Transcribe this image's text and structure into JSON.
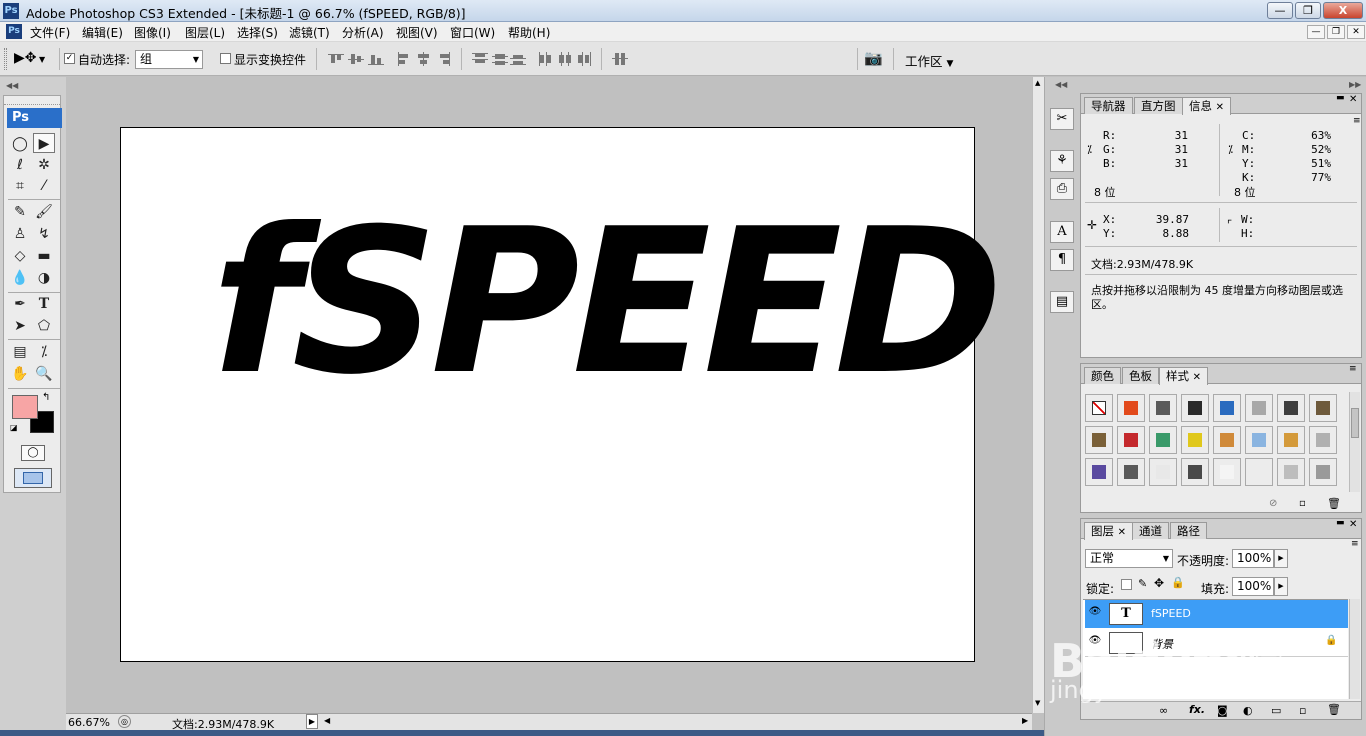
{
  "window": {
    "app_icon": "Ps",
    "title": "Adobe Photoshop CS3 Extended - [未标题-1 @ 66.7% (fSPEED, RGB/8)]",
    "min_label": "—",
    "max_label": "❐",
    "close_label": "X"
  },
  "menubar": {
    "icon": "Ps",
    "items": [
      "文件(F)",
      "编辑(E)",
      "图像(I)",
      "图层(L)",
      "选择(S)",
      "滤镜(T)",
      "分析(A)",
      "视图(V)",
      "窗口(W)",
      "帮助(H)"
    ]
  },
  "options": {
    "auto_select_label": "自动选择:",
    "auto_select_checked": true,
    "auto_select_value": "组",
    "show_transform_label": "显示变换控件",
    "show_transform_checked": false,
    "workspace_label": "工作区"
  },
  "toolbox": {
    "header": "Ps",
    "foreground_color": "#f7a5a5",
    "background_color": "#000000"
  },
  "canvas": {
    "text": "fSPEED"
  },
  "status": {
    "zoom": "66.67%",
    "doc_size": "文档:2.93M/478.9K"
  },
  "info_panel": {
    "tabs": [
      "导航器",
      "直方图",
      "信息"
    ],
    "active_tab": "信息",
    "rgb": [
      {
        "k": "R:",
        "v": "31"
      },
      {
        "k": "G:",
        "v": "31"
      },
      {
        "k": "B:",
        "v": "31"
      }
    ],
    "cmyk": [
      {
        "k": "C:",
        "v": "63%"
      },
      {
        "k": "M:",
        "v": "52%"
      },
      {
        "k": "Y:",
        "v": "51%"
      },
      {
        "k": "K:",
        "v": "77%"
      }
    ],
    "bits_left": "8 位",
    "bits_right": "8 位",
    "x_label": "X:",
    "x_value": "39.87",
    "y_label": "Y:",
    "y_value": "8.88",
    "w_label": "W:",
    "h_label": "H:",
    "doc_size": "文档:2.93M/478.9K",
    "hint": "点按并拖移以沿限制为 45 度增量方向移动图层或选区。"
  },
  "styles_panel": {
    "tabs": [
      "颜色",
      "色板",
      "样式"
    ],
    "active_tab": "样式",
    "swatch_colors": [
      "#ffffff",
      "#e24a1c",
      "#5a5a5a",
      "#2a2a2a",
      "#2a6bbf",
      "#a8a8a8",
      "#3e3e3e",
      "#6e5a3c",
      "#7a6038",
      "#c4282c",
      "#3a9a6a",
      "#e0c81c",
      "#d08a3a",
      "#8ab4e0",
      "#d49a3a",
      "#b0b0b0",
      "#5a4aa0",
      "#5a5a5a",
      "#e8e8e8",
      "#4a4a4a",
      "#f4f4f4",
      "#ececec",
      "#bdbdbd",
      "#9a9a9a"
    ]
  },
  "layers_panel": {
    "tabs": [
      "图层",
      "通道",
      "路径"
    ],
    "active_tab": "图层",
    "blend_mode": "正常",
    "opacity_label": "不透明度:",
    "opacity_value": "100%",
    "lock_label": "锁定:",
    "fill_label": "填充:",
    "fill_value": "100%",
    "layers": [
      {
        "name": "fSPEED",
        "thumb": "T",
        "selected": true
      },
      {
        "name": "背景",
        "thumb": "",
        "selected": false
      }
    ],
    "footer_icons": [
      "link-icon",
      "fx-icon",
      "mask-icon",
      "adjustment-icon",
      "group-icon",
      "new-layer-icon",
      "trash-icon"
    ]
  },
  "watermark": {
    "line1": "Baidu经验",
    "line2": "jingyan.baidu.com"
  }
}
